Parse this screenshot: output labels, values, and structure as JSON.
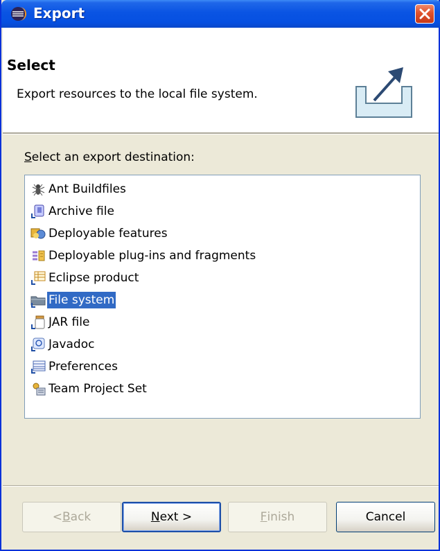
{
  "window": {
    "title": "Export",
    "colors": {
      "titlebar": "#0a54e3",
      "selection": "#316ac5",
      "close": "#e0512b"
    }
  },
  "header": {
    "title": "Select",
    "description": "Export resources to the local file system."
  },
  "prompt": {
    "mnemonic": "S",
    "rest": "elect an export destination:"
  },
  "list": {
    "items": [
      {
        "label": "Ant Buildfiles",
        "icon": "ant-icon",
        "selected": false
      },
      {
        "label": "Archive file",
        "icon": "archive-icon",
        "selected": false
      },
      {
        "label": "Deployable features",
        "icon": "feature-icon",
        "selected": false
      },
      {
        "label": "Deployable plug-ins and fragments",
        "icon": "plugin-icon",
        "selected": false
      },
      {
        "label": "Eclipse product",
        "icon": "product-icon",
        "selected": false
      },
      {
        "label": "File system",
        "icon": "folder-icon",
        "selected": true
      },
      {
        "label": "JAR file",
        "icon": "jar-icon",
        "selected": false
      },
      {
        "label": "Javadoc",
        "icon": "javadoc-icon",
        "selected": false
      },
      {
        "label": "Preferences",
        "icon": "preferences-icon",
        "selected": false
      },
      {
        "label": "Team Project Set",
        "icon": "team-icon",
        "selected": false
      }
    ]
  },
  "buttons": {
    "back": {
      "pre": "< ",
      "mn": "B",
      "post": "ack"
    },
    "next": {
      "pre": "",
      "mn": "N",
      "post": "ext >"
    },
    "finish": {
      "pre": "",
      "mn": "F",
      "post": "inish"
    },
    "cancel": {
      "label": "Cancel"
    }
  }
}
